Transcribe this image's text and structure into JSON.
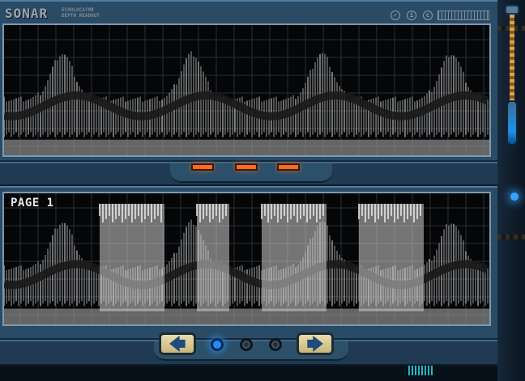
{
  "app": {
    "logo": "SONAR",
    "subtitle_line1": "ECHOLOCATOR",
    "subtitle_line2": "DEPTH READOUT"
  },
  "icons": {
    "settings": "gear-icon",
    "info": "info-icon",
    "sound": "sound-icon",
    "meter": "level-meter-icon",
    "prev": "arrow-left-icon",
    "next": "arrow-right-icon"
  },
  "pager": {
    "page_label": "PAGE 1",
    "prev_glyph": "🡄",
    "next_glyph": "🡆",
    "pages": 3,
    "active_index": 0
  },
  "colors": {
    "panel": "#2a4b66",
    "screen": "#050608",
    "signal": "#bfbfbf",
    "indicator": "#ff6a1a",
    "active_dot": "#1f8dff",
    "nav_button": "#d9c88f"
  }
}
